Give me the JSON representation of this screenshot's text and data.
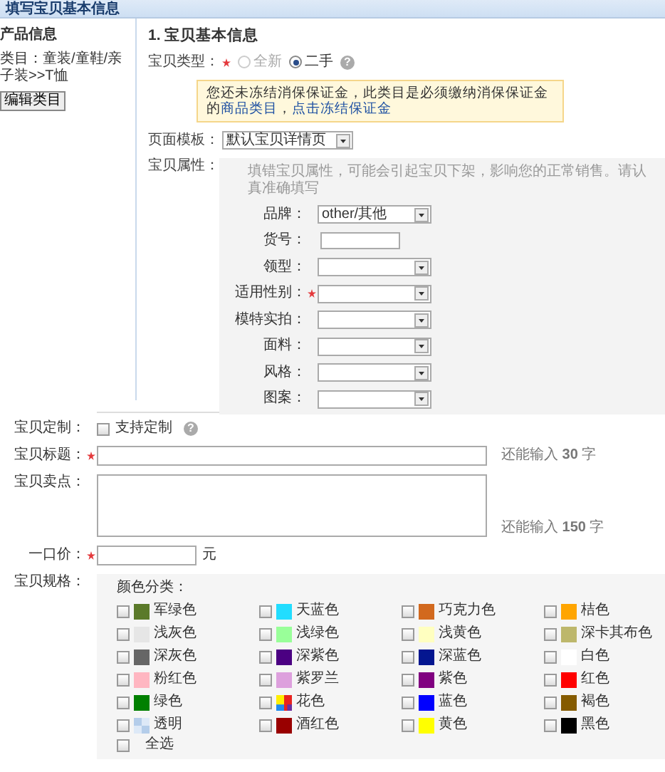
{
  "header": {
    "title": "填写宝贝基本信息"
  },
  "sidebar": {
    "heading": "产品信息",
    "category": "类目：童装/童鞋/亲子装>>T恤",
    "button": "编辑类目"
  },
  "section": {
    "title": "1. 宝贝基本信息"
  },
  "item_type": {
    "label": "宝贝类型：",
    "required": true,
    "help": "?",
    "options": [
      {
        "label": "全新",
        "selected": false,
        "disabled": true
      },
      {
        "label": "二手",
        "selected": true,
        "disabled": false
      }
    ]
  },
  "notice": {
    "parts": [
      {
        "kind": "plain",
        "text": "您还未冻结消保保证金，此类目是必须缴纳消保保证金的"
      },
      {
        "kind": "link",
        "text": "商品类目"
      },
      {
        "kind": "plain",
        "text": "，"
      },
      {
        "kind": "link",
        "text": "点击冻结保证金"
      }
    ]
  },
  "template": {
    "label": "页面模板：",
    "value": "默认宝贝详情页"
  },
  "attributes": {
    "label": "宝贝属性：",
    "hint": "填错宝贝属性，可能会引起宝贝下架，影响您的正常销售。请认真准确填写",
    "rows": [
      {
        "label": "品牌：",
        "kind": "select",
        "required": false,
        "value": "other/其他"
      },
      {
        "label": "货号：",
        "kind": "text",
        "required": false
      },
      {
        "label": "领型：",
        "kind": "select",
        "required": false
      },
      {
        "label": "适用性别：",
        "kind": "select",
        "required": true
      },
      {
        "label": "模特实拍：",
        "kind": "select",
        "required": false
      },
      {
        "label": "面料：",
        "kind": "select",
        "required": false
      },
      {
        "label": "风格：",
        "kind": "select",
        "required": false
      },
      {
        "label": "图案：",
        "kind": "select",
        "required": false
      }
    ]
  },
  "customize": {
    "label": "宝贝定制：",
    "option": "支持定制",
    "checked": false,
    "help": "?"
  },
  "title_field": {
    "label": "宝贝标题：",
    "required": true,
    "counter": "还能输入 **30** 字"
  },
  "selling_points": {
    "label": "宝贝卖点：",
    "required": false,
    "counter": "还能输入 **150** 字"
  },
  "price": {
    "label": "一口价：",
    "required": true,
    "unit": "元"
  },
  "spec": {
    "label": "宝贝规格：",
    "group_title": "颜色分类：",
    "colors": [
      {
        "label": "军绿色",
        "kind": "swatch",
        "color": "#5b7a2a",
        "checked": false
      },
      {
        "label": "天蓝色",
        "kind": "swatch",
        "color": "#22ddff",
        "checked": false
      },
      {
        "label": "巧克力色",
        "kind": "swatch",
        "color": "#d2691e",
        "checked": false
      },
      {
        "label": "桔色",
        "kind": "swatch",
        "color": "#ffa500",
        "checked": false
      },
      {
        "label": "浅灰色",
        "kind": "swatch",
        "color": "#e6e6e6",
        "checked": false
      },
      {
        "label": "浅绿色",
        "kind": "swatch",
        "color": "#99ff99",
        "checked": false
      },
      {
        "label": "浅黄色",
        "kind": "swatch",
        "color": "#ffffc0",
        "checked": false
      },
      {
        "label": "深卡其布色",
        "kind": "swatch",
        "color": "#bdb76b",
        "checked": false
      },
      {
        "label": "深灰色",
        "kind": "swatch",
        "color": "#666666",
        "checked": false
      },
      {
        "label": "深紫色",
        "kind": "swatch",
        "color": "#4b0082",
        "checked": false
      },
      {
        "label": "深蓝色",
        "kind": "swatch",
        "color": "#041690",
        "checked": false
      },
      {
        "label": "白色",
        "kind": "swatch",
        "color": "#ffffff",
        "checked": false
      },
      {
        "label": "粉红色",
        "kind": "swatch",
        "color": "#ffb6c1",
        "checked": false
      },
      {
        "label": "紫罗兰",
        "kind": "swatch",
        "color": "#dda0dd",
        "checked": false
      },
      {
        "label": "紫色",
        "kind": "swatch",
        "color": "#800080",
        "checked": false
      },
      {
        "label": "红色",
        "kind": "swatch",
        "color": "#ff0000",
        "checked": false
      },
      {
        "label": "绿色",
        "kind": "swatch",
        "color": "#008000",
        "checked": false
      },
      {
        "label": "花色",
        "kind": "multicolor",
        "checked": false
      },
      {
        "label": "蓝色",
        "kind": "swatch",
        "color": "#0000ff",
        "checked": false
      },
      {
        "label": "褐色",
        "kind": "swatch",
        "color": "#855b00",
        "checked": false
      },
      {
        "label": "透明",
        "kind": "transparent",
        "checked": false
      },
      {
        "label": "酒红色",
        "kind": "swatch",
        "color": "#990000",
        "checked": false
      },
      {
        "label": "黄色",
        "kind": "swatch",
        "color": "#ffff00",
        "checked": false
      },
      {
        "label": "黑色",
        "kind": "swatch",
        "color": "#000000",
        "checked": false
      }
    ],
    "select_all": {
      "label": "全选",
      "checked": false
    }
  }
}
